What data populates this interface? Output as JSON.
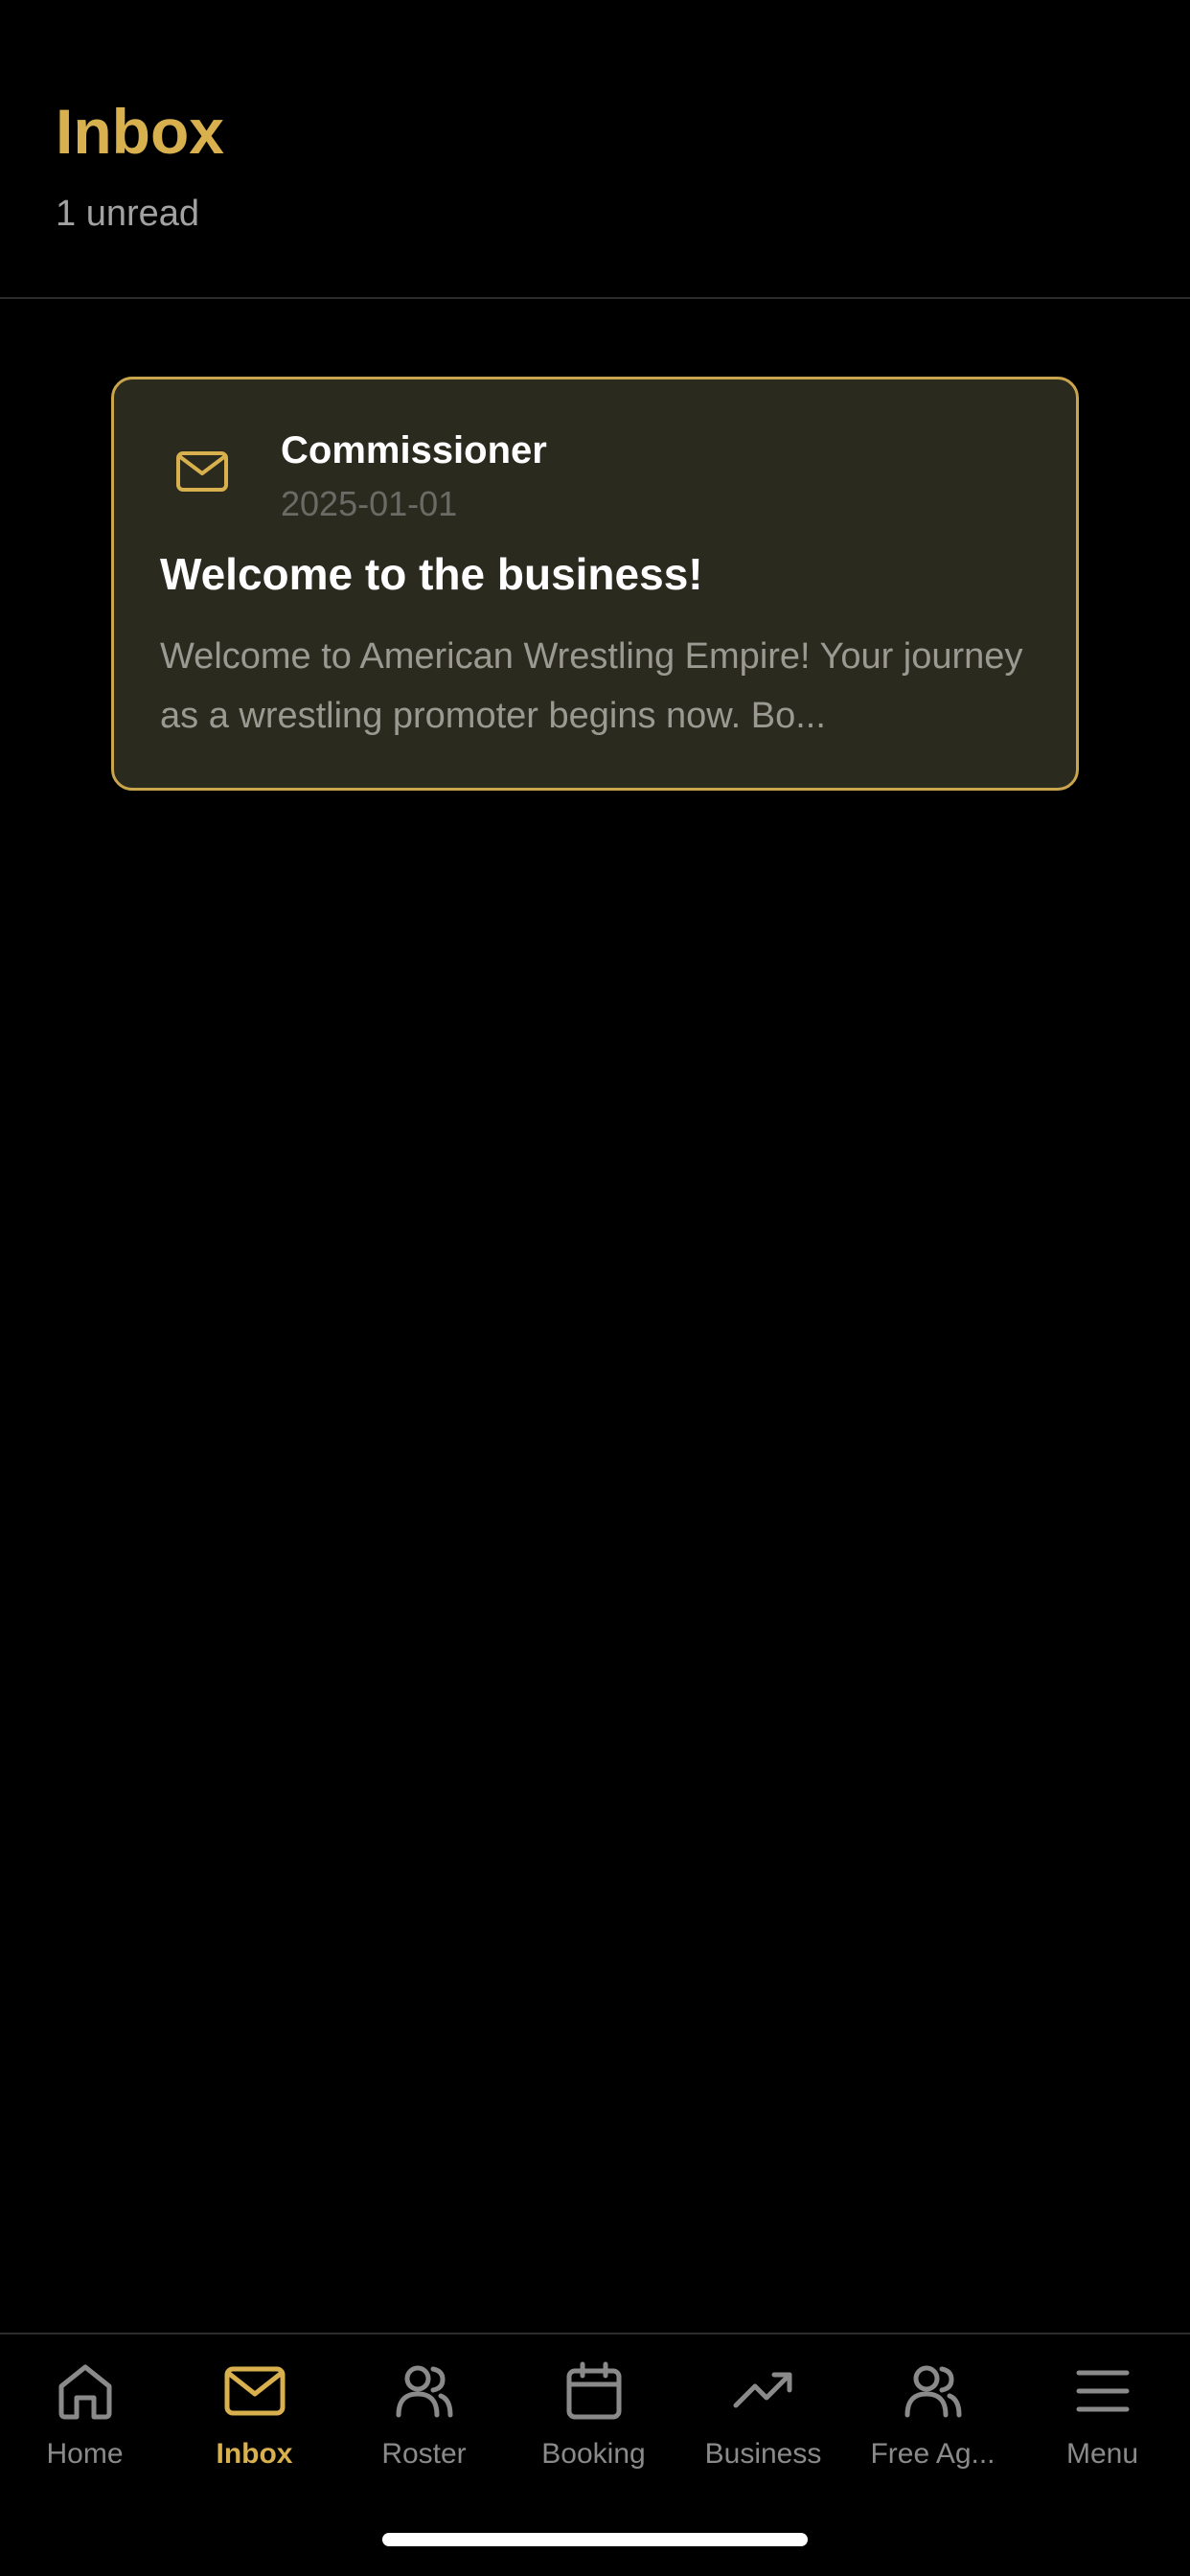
{
  "header": {
    "title": "Inbox",
    "unread": "1 unread"
  },
  "messages": [
    {
      "icon": "mail-icon",
      "sender": "Commissioner",
      "date": "2025-01-01",
      "subject": "Welcome to the business!",
      "preview": "Welcome to American Wrestling Empire! Your journey as a wrestling promoter begins now. Bo..."
    }
  ],
  "tabs": [
    {
      "label": "Home",
      "icon": "home-icon",
      "active": false
    },
    {
      "label": "Inbox",
      "icon": "mail-icon",
      "active": true
    },
    {
      "label": "Roster",
      "icon": "users-icon",
      "active": false
    },
    {
      "label": "Booking",
      "icon": "calendar-icon",
      "active": false
    },
    {
      "label": "Business",
      "icon": "trending-up-icon",
      "active": false
    },
    {
      "label": "Free Ag...",
      "icon": "users-icon",
      "active": false
    },
    {
      "label": "Menu",
      "icon": "menu-icon",
      "active": false
    }
  ],
  "colors": {
    "accent": "#d9b04e",
    "background": "#000000",
    "card_background": "#2b2a1f",
    "card_border": "#c9a54c",
    "inactive_tab": "#8a8a8a"
  }
}
